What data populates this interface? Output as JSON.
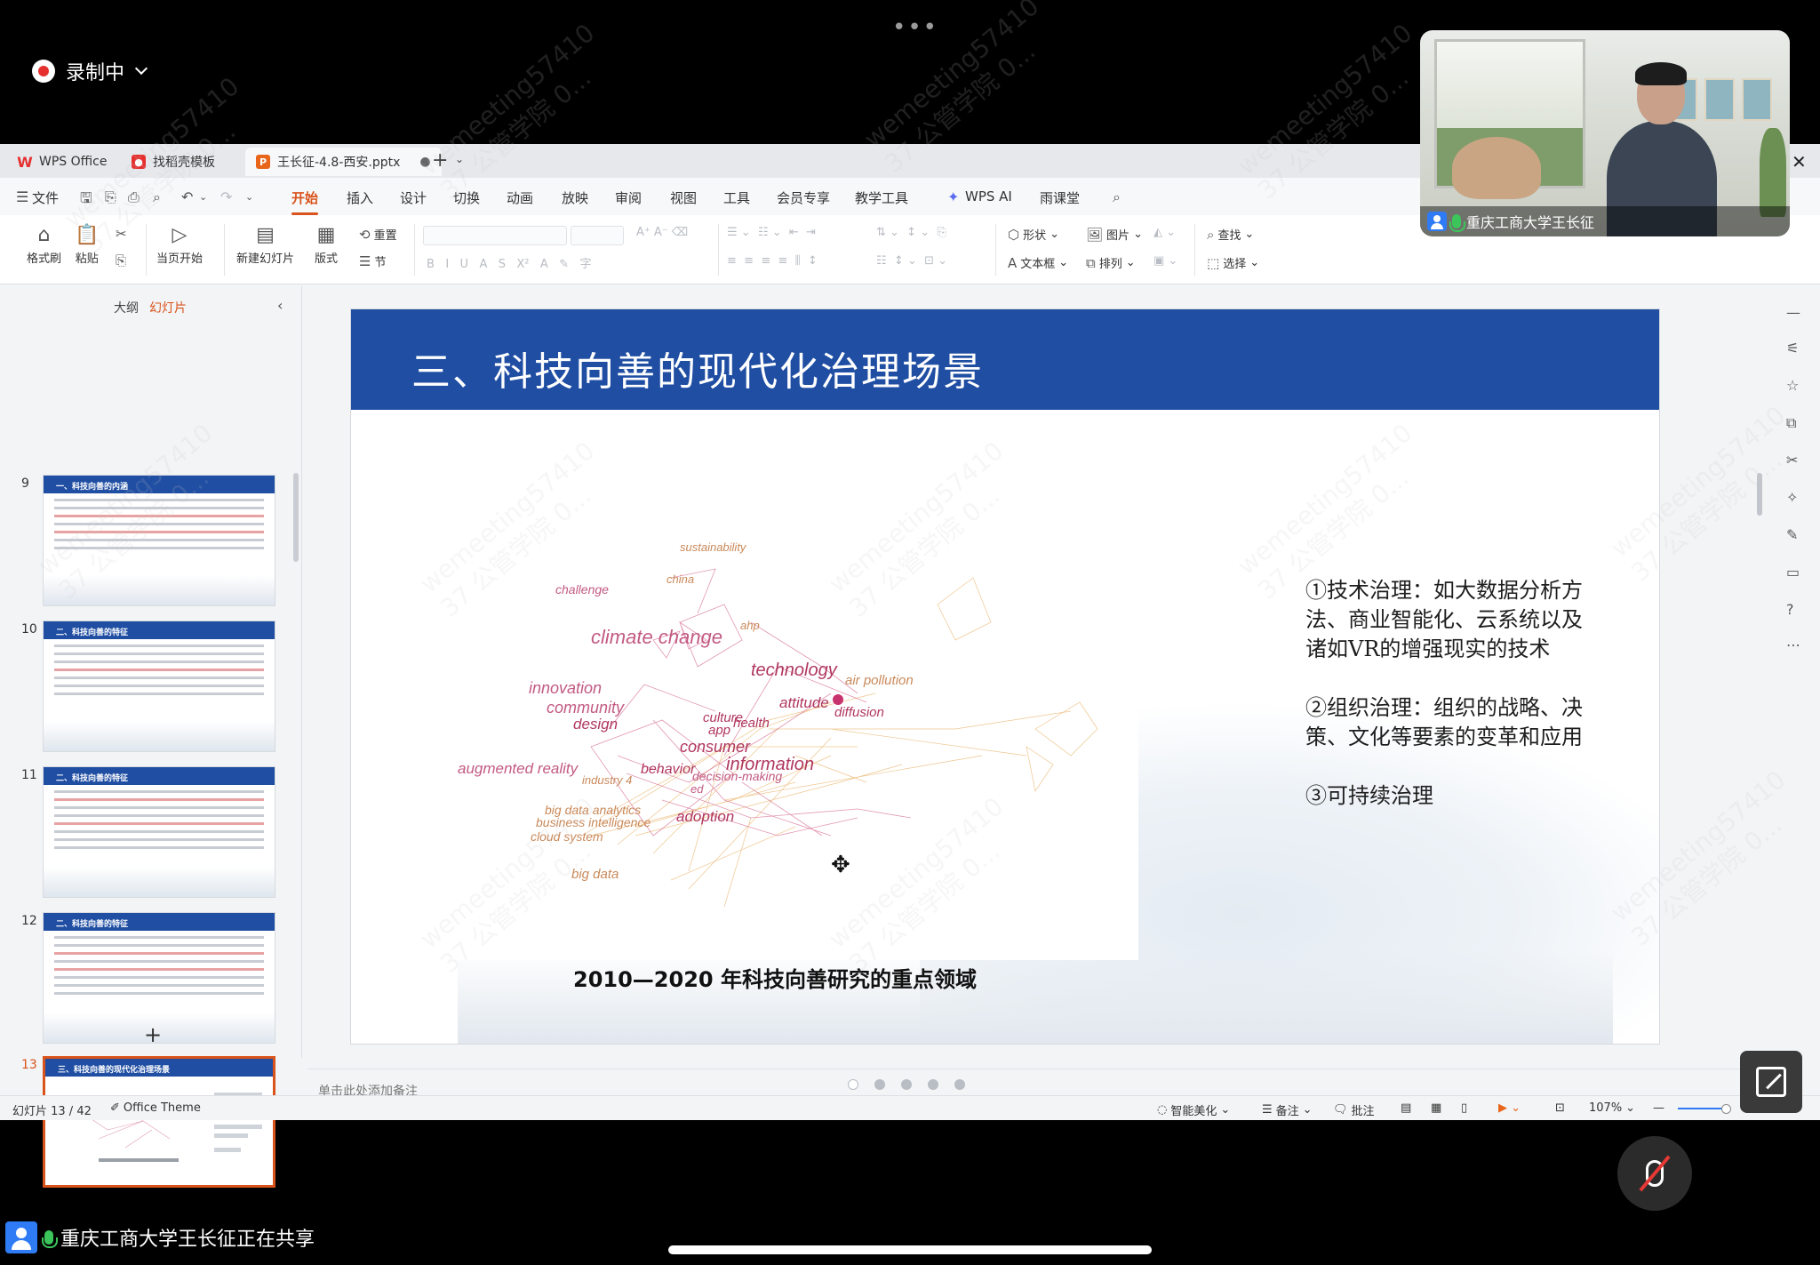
{
  "meeting": {
    "top_dots": "•••",
    "recording_label": "录制中",
    "presenter_video_label": "重庆工商大学王长征",
    "sharing_status": "重庆工商大学王长征正在共享",
    "watermark_line1": "wemeeting57410",
    "watermark_line2": "37 公管学院 0..."
  },
  "tabs": [
    {
      "label": "WPS Office",
      "icon": "wps-logo-icon",
      "color": "#e5302f"
    },
    {
      "label": "找稻壳模板",
      "icon": "docer-logo-icon",
      "color": "#e5302f"
    },
    {
      "label": "王长征-4.8-西安.pptx",
      "icon": "presentation-file-icon",
      "color": "#e8651a"
    }
  ],
  "menu": {
    "file": "文件",
    "items": [
      "开始",
      "插入",
      "设计",
      "切换",
      "动画",
      "放映",
      "审阅",
      "视图",
      "工具",
      "会员专享",
      "教学工具",
      "WPS AI",
      "雨课堂"
    ],
    "active": "开始"
  },
  "ribbon": {
    "format_painter": "格式刷",
    "paste": "粘贴",
    "play_from_current": "当页开始",
    "new_slide": "新建幻灯片",
    "layout": "版式",
    "reset": "重置",
    "section": "节",
    "shape": "形状",
    "picture": "图片",
    "textbox": "文本框",
    "arrange": "排列",
    "find": "查找",
    "select": "选择"
  },
  "left_panel": {
    "tab_outline": "大纲",
    "tab_slides": "幻灯片",
    "thumbnails": [
      {
        "num": "9",
        "title": "一、科技向善的内涵"
      },
      {
        "num": "10",
        "title": "二、科技向善的特征"
      },
      {
        "num": "11",
        "title": "二、科技向善的特征"
      },
      {
        "num": "12",
        "title": "二、科技向善的特征"
      },
      {
        "num": "13",
        "title": "三、科技向善的现代化治理场景"
      }
    ],
    "add_slide": "+"
  },
  "slide": {
    "title": "三、科技向善的现代化治理场景",
    "points": [
      "①技术治理：如大数据分析方法、商业智能化、云系统以及诸如VR的增强现实的技术",
      "②组织治理：组织的战略、决策、文化等要素的变革和应用",
      "③可持续治理"
    ],
    "caption": "2010—2020 年科技向善研究的重点领域",
    "keywords": [
      "sustainability",
      "china",
      "challenge",
      "climate change",
      "ahp",
      "technology",
      "air pollution",
      "innovation",
      "community",
      "attitude",
      "diffusion",
      "design",
      "culture",
      "health",
      "app",
      "consumer",
      "information",
      "augmented reality",
      "industry 4",
      "behavior",
      "decision-making",
      "ed",
      "big data analytics",
      "business intelligence",
      "adoption",
      "cloud system",
      "big data"
    ]
  },
  "notes": {
    "placeholder": "单击此处添加备注"
  },
  "status": {
    "slide_counter": "幻灯片 13 / 42",
    "theme": "Office Theme",
    "beautify": "智能美化",
    "notes": "备注",
    "comments": "批注",
    "zoom": "107%"
  }
}
